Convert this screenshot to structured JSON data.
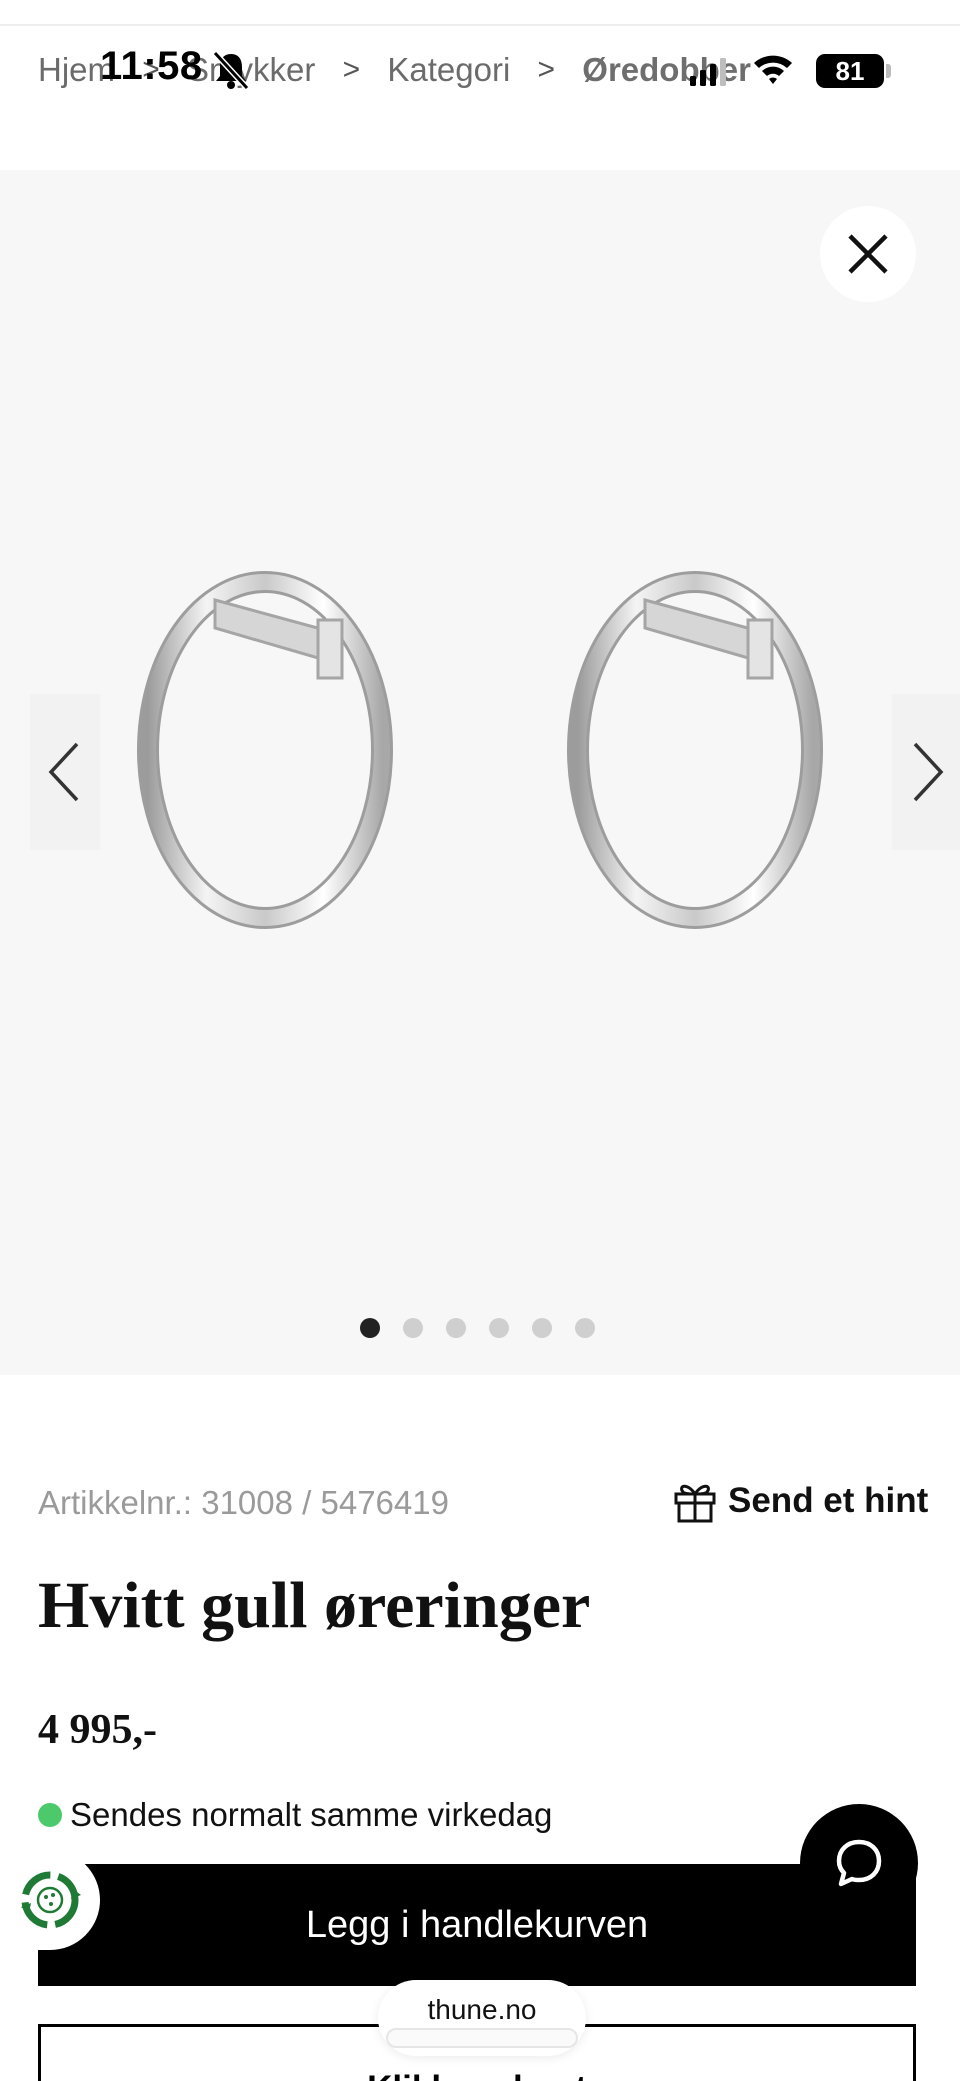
{
  "status_bar": {
    "time": "11:58",
    "battery": "81"
  },
  "breadcrumb": {
    "items": [
      "Hjem",
      "Smykker",
      "Kategori",
      "Øredobber"
    ],
    "separator": ">"
  },
  "gallery": {
    "slide_count": 6,
    "active_index": 0
  },
  "product": {
    "sku": "Artikkelnr.: 31008 / 5476419",
    "hint_label": "Send et hint",
    "title": "Hvitt gull øreringer",
    "price": "4 995,-",
    "stock_status": "Sendes normalt samme virkedag",
    "stock_color": "#4cc96a"
  },
  "actions": {
    "add_to_cart": "Legg i handlekurven",
    "click_and_collect": "Klikk og hent"
  },
  "browser": {
    "url": "thune.no"
  }
}
